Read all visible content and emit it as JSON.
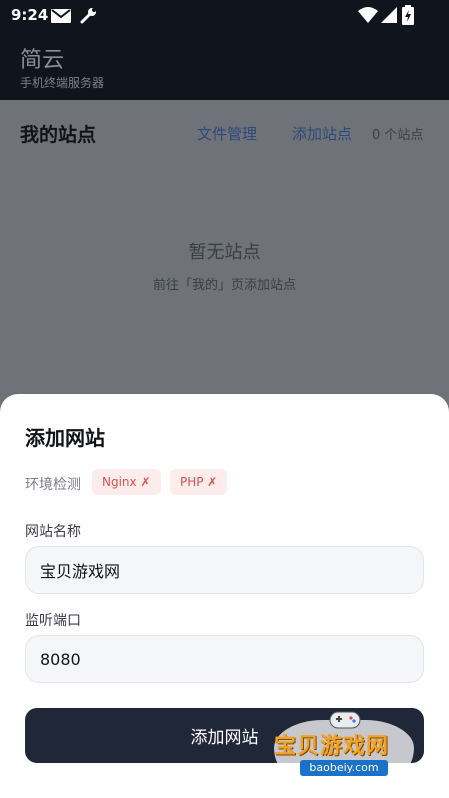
{
  "status": {
    "time": "9:24"
  },
  "app": {
    "title": "简云",
    "subtitle": "手机终端服务器"
  },
  "sites": {
    "heading": "我的站点",
    "file_manager": "文件管理",
    "add_site": "添加站点",
    "count": "0 个站点",
    "empty_title": "暂无站点",
    "empty_hint": "前往「我的」页添加站点"
  },
  "dialog": {
    "title": "添加网站",
    "env_label": "环境检测",
    "env_checks": [
      {
        "label": "Nginx ✗"
      },
      {
        "label": "PHP ✗"
      }
    ],
    "name_label": "网站名称",
    "name_value": "宝贝游戏网",
    "port_label": "监听端口",
    "port_value": "8080",
    "submit": "添加网站"
  },
  "watermark": {
    "text": "宝贝游戏网",
    "url": "baobeiy.com"
  },
  "colors": {
    "header_bg": "#0f141d",
    "accent": "#1f2738",
    "error_chip_bg": "#fdecec",
    "error_chip_text": "#d9534f"
  }
}
